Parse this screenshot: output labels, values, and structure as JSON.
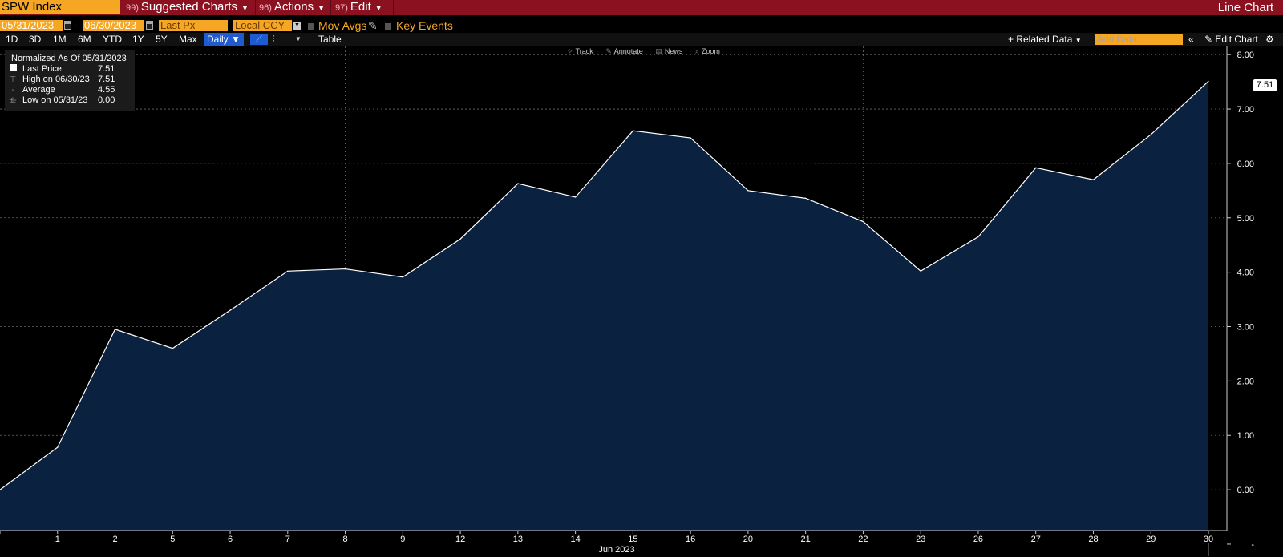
{
  "header": {
    "ticker": "SPW Index",
    "menu": [
      {
        "num": "99)",
        "label": "Suggested Charts"
      },
      {
        "num": "96)",
        "label": "Actions"
      },
      {
        "num": "97)",
        "label": "Edit"
      }
    ],
    "chart_type": "Line Chart"
  },
  "controls": {
    "start_date": "05/31/2023",
    "end_date": "06/30/2023",
    "separator": "-",
    "field": "Last Px",
    "currency": "Local CCY",
    "mov_avgs": "Mov Avgs",
    "key_events": "Key Events"
  },
  "periods": [
    "1D",
    "3D",
    "1M",
    "6M",
    "YTD",
    "1Y",
    "5Y",
    "Max"
  ],
  "frequency": "Daily",
  "table_label": "Table",
  "toolbar_right": {
    "related_data": "Related Data",
    "add_data_placeholder": "Add Data",
    "edit_chart": "Edit Chart"
  },
  "chart_tools": [
    "Track",
    "Annotate",
    "News",
    "Zoom"
  ],
  "legend": {
    "title": "Normalized As Of 05/31/2023",
    "rows": [
      {
        "label": "Last Price",
        "value": "7.51"
      },
      {
        "label": "High on 06/30/23",
        "value": "7.51"
      },
      {
        "label": "Average",
        "value": "4.55"
      },
      {
        "label": "Low on 05/31/23",
        "value": "0.00"
      }
    ]
  },
  "last_value_tag": "7.51",
  "colors": {
    "topbar": "#8b1020",
    "accent": "#f5a623",
    "selected": "#1e5bd0",
    "area_fill": "#0b2140",
    "line": "#ffffff",
    "grid": "#6a6a6a"
  },
  "chart_data": {
    "type": "area",
    "title": "",
    "xlabel": "Jun 2023",
    "ylabel": "",
    "categories": [
      "",
      "1",
      "2",
      "5",
      "6",
      "7",
      "8",
      "9",
      "12",
      "13",
      "14",
      "15",
      "16",
      "20",
      "21",
      "22",
      "23",
      "26",
      "27",
      "28",
      "29",
      "30"
    ],
    "dates": [
      "2023-05-31",
      "2023-06-01",
      "2023-06-02",
      "2023-06-05",
      "2023-06-06",
      "2023-06-07",
      "2023-06-08",
      "2023-06-09",
      "2023-06-12",
      "2023-06-13",
      "2023-06-14",
      "2023-06-15",
      "2023-06-16",
      "2023-06-20",
      "2023-06-21",
      "2023-06-22",
      "2023-06-23",
      "2023-06-26",
      "2023-06-27",
      "2023-06-28",
      "2023-06-29",
      "2023-06-30"
    ],
    "values": [
      0.0,
      0.78,
      2.95,
      2.6,
      3.3,
      4.02,
      4.06,
      3.91,
      4.61,
      5.63,
      5.38,
      6.6,
      6.47,
      5.5,
      5.36,
      4.93,
      4.02,
      4.65,
      5.92,
      5.7,
      6.53,
      7.51
    ],
    "y_ticks": [
      "-",
      "0.00",
      "1.00",
      "2.00",
      "3.00",
      "4.00",
      "5.00",
      "6.00",
      "7.00",
      "8.00"
    ],
    "y_tick_values": [
      -1,
      0,
      1,
      2,
      3,
      4,
      5,
      6,
      7,
      8
    ],
    "ylim": [
      -0.75,
      8.15
    ],
    "grid": true,
    "vertical_grid_at": [
      "8",
      "15",
      "22"
    ],
    "legend_position": "top-left",
    "y_axis_position": "right"
  }
}
